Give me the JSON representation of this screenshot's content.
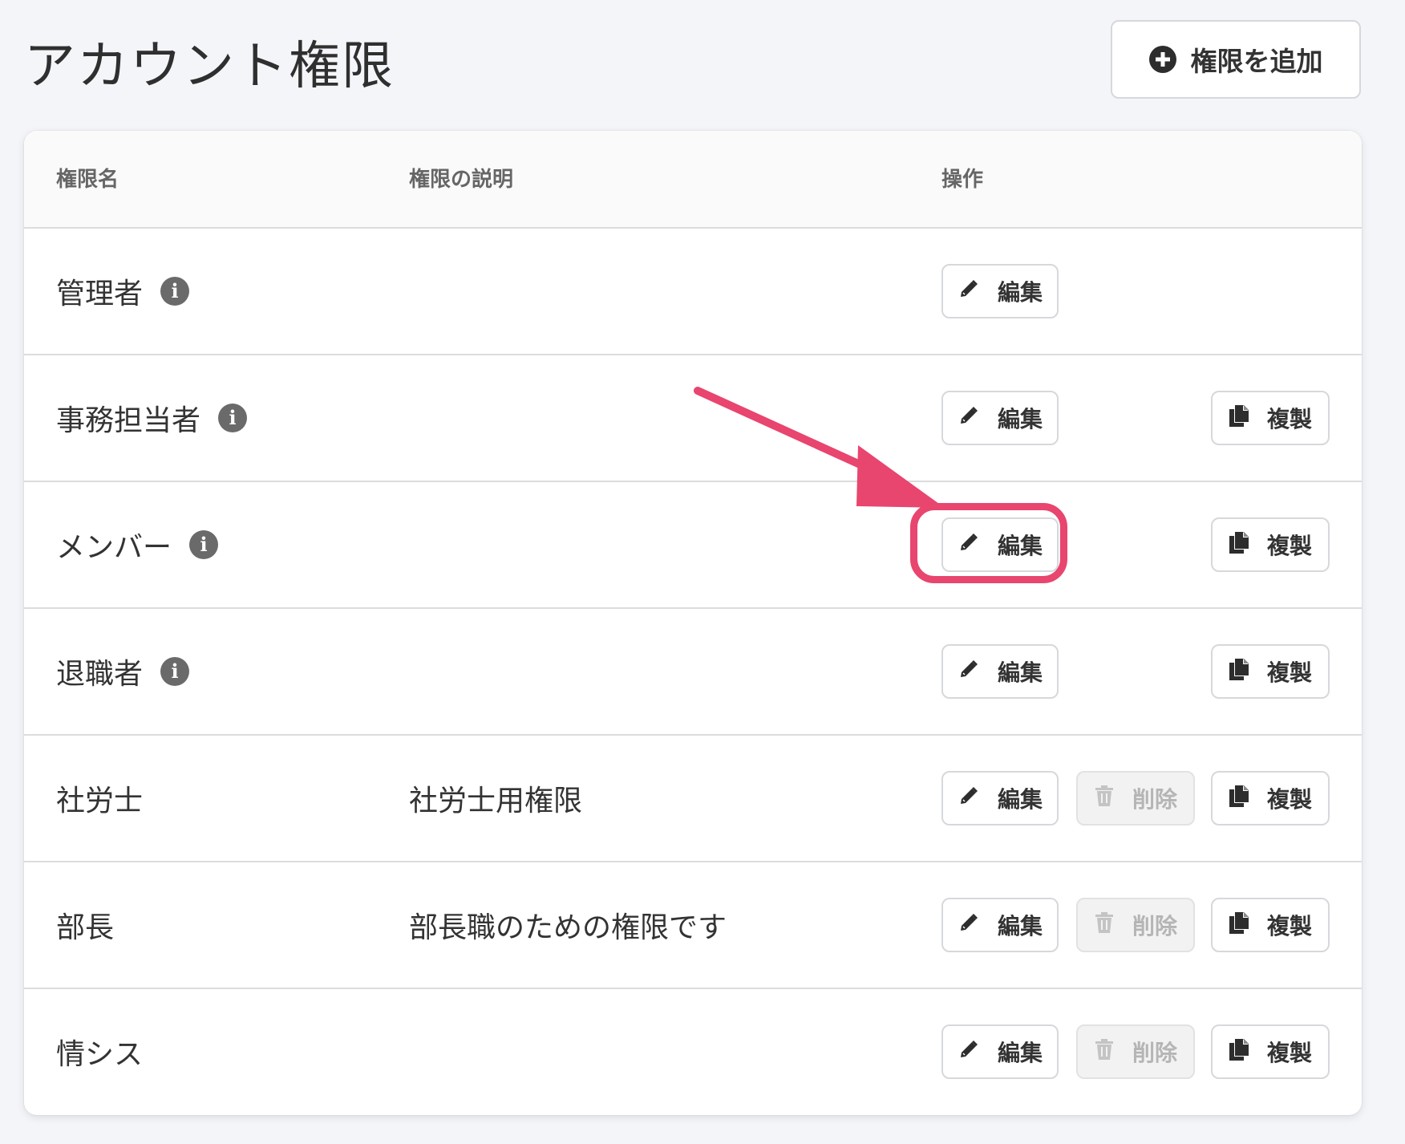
{
  "page": {
    "title": "アカウント権限",
    "add_button_label": "権限を追加"
  },
  "table": {
    "headers": {
      "name": "権限名",
      "description": "権限の説明",
      "actions": "操作"
    },
    "rows": [
      {
        "name": "管理者",
        "has_info": true,
        "description": "",
        "actions": [
          "edit"
        ]
      },
      {
        "name": "事務担当者",
        "has_info": true,
        "description": "",
        "actions": [
          "edit",
          "copy"
        ]
      },
      {
        "name": "メンバー",
        "has_info": true,
        "description": "",
        "actions": [
          "edit",
          "copy"
        ],
        "highlighted_action": "edit"
      },
      {
        "name": "退職者",
        "has_info": true,
        "description": "",
        "actions": [
          "edit",
          "copy"
        ]
      },
      {
        "name": "社労士",
        "has_info": false,
        "description": "社労士用権限",
        "actions": [
          "edit",
          "delete",
          "copy"
        ],
        "delete_disabled": true
      },
      {
        "name": "部長",
        "has_info": false,
        "description": "部長職のための権限です",
        "actions": [
          "edit",
          "delete",
          "copy"
        ],
        "delete_disabled": true
      },
      {
        "name": "情シス",
        "has_info": false,
        "description": "",
        "actions": [
          "edit",
          "delete",
          "copy"
        ],
        "delete_disabled": true
      }
    ]
  },
  "labels": {
    "edit": "編集",
    "delete": "削除",
    "copy": "複製",
    "info_glyph": "i"
  },
  "icons": {
    "add": "plus-circle-icon",
    "edit": "pencil-icon",
    "delete": "trash-icon",
    "copy": "copy-icon",
    "info": "info-circle-icon"
  },
  "colors": {
    "background": "#f4f5f9",
    "annotation": "#e8456f",
    "disabled_text": "#b5b5b5"
  }
}
